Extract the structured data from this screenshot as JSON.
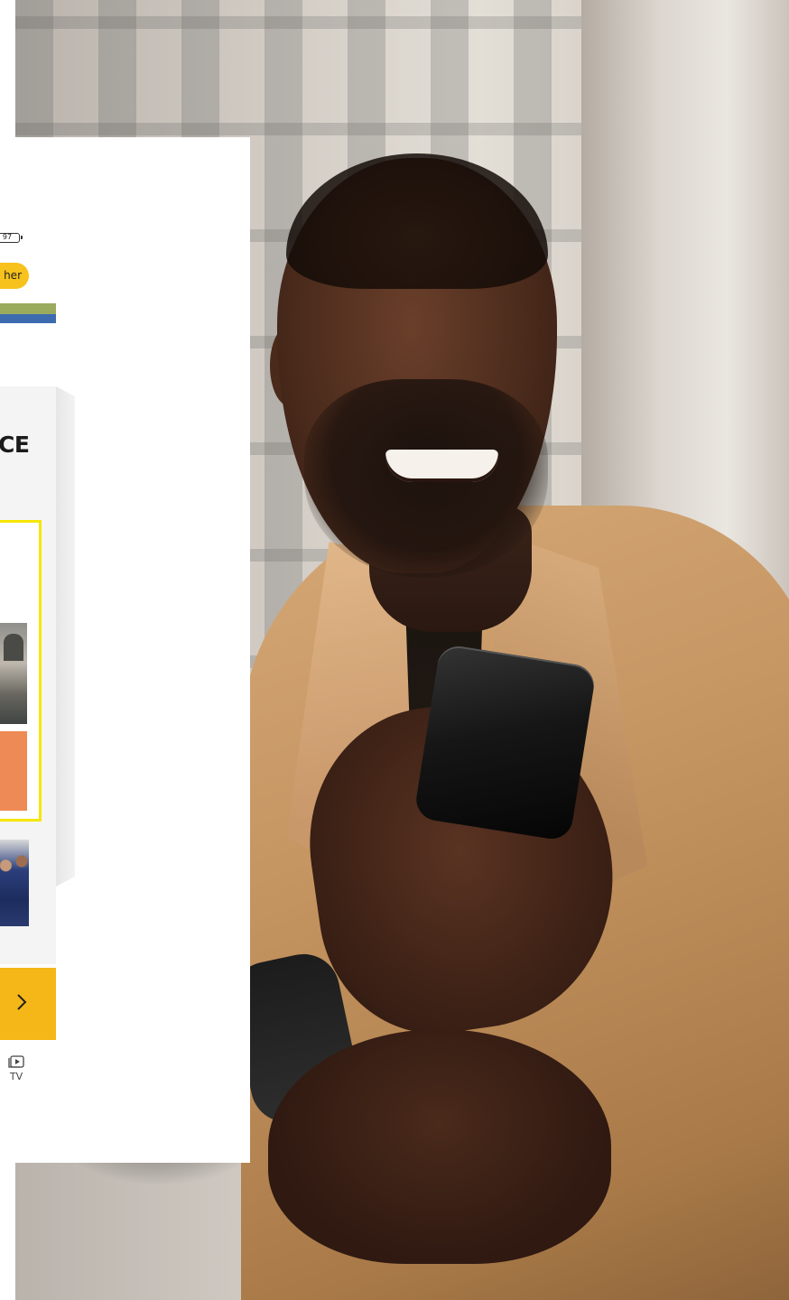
{
  "status_bar": {
    "battery": "97"
  },
  "header": {
    "pill_button_label": "her"
  },
  "main": {
    "heading": "CE"
  },
  "bottom_nav": {
    "items": [
      {
        "label": "TV",
        "icon": "tv-play-icon"
      }
    ]
  },
  "cta": {
    "icon": "chevron-right-icon"
  },
  "colors": {
    "accent_yellow": "#f6c21b",
    "highlight_yellow": "#f5e600",
    "stripe_green": "#9aab5d",
    "stripe_blue": "#3c6bb0",
    "cta_orange": "#f5b618"
  }
}
